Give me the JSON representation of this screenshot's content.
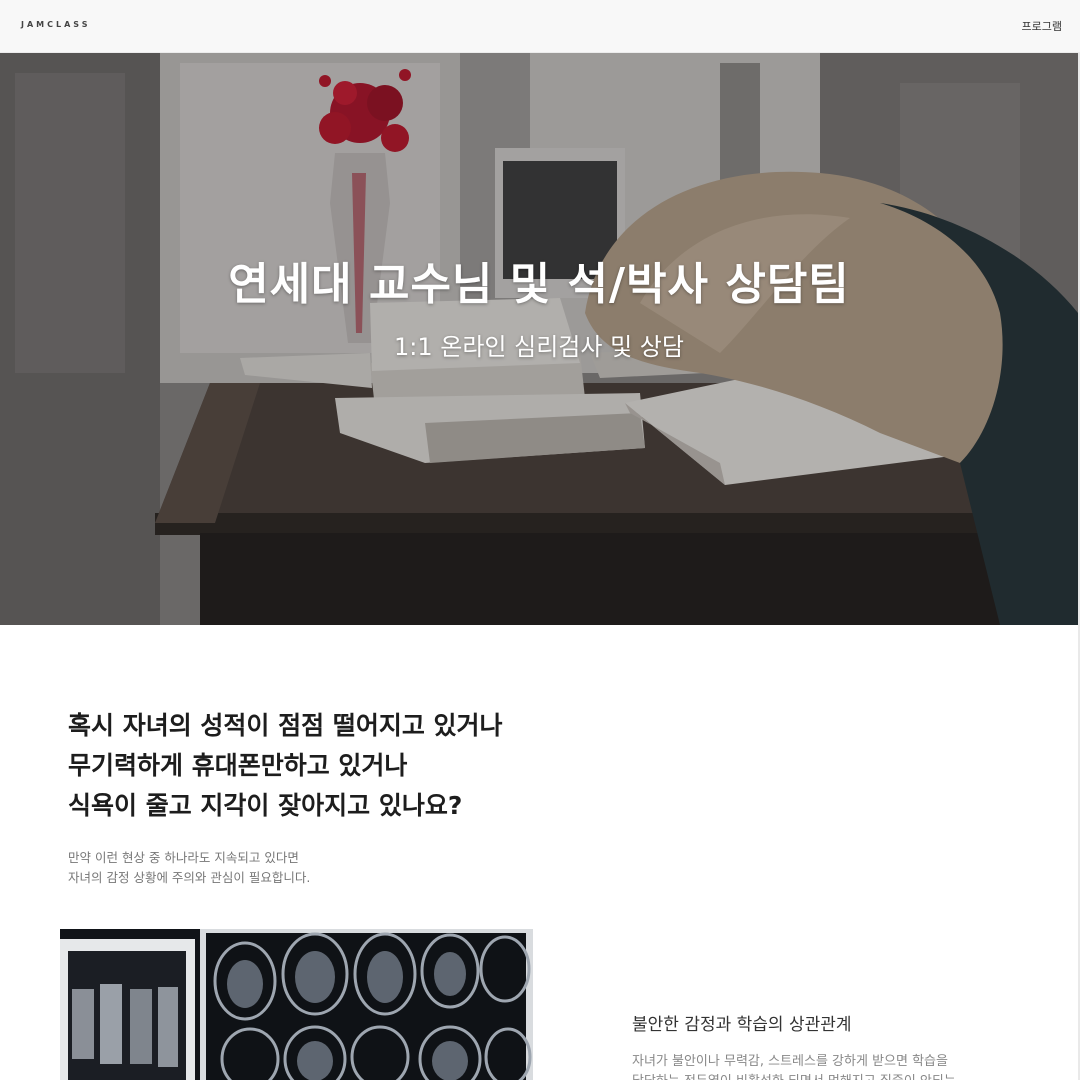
{
  "header": {
    "logo": "JAMCLASS",
    "nav_program": "프로그램"
  },
  "hero": {
    "title": "연세대 교수님 및 석/박사 상담팀",
    "subtitle": "1:1 온라인 심리검사 및 상담"
  },
  "intro": {
    "heading_lines": [
      "혹시 자녀의 성적이 점점 떨어지고 있거나",
      "무기력하게 휴대폰만하고 있거나",
      "식욕이 줄고 지각이 잦아지고 있나요?"
    ],
    "desc_lines": [
      "만약 이런 현상 중 하나라도 지속되고 있다면",
      "자녀의 감정 상황에 주의와 관심이 필요합니다."
    ]
  },
  "feature": {
    "title": "불안한 감정과 학습의 상관관계",
    "body_lines": [
      "자녀가 불안이나 무력감, 스트레스를 강하게 받으면 학습을",
      "담당하는 전두엽이 비활성화 되면서 멍해지고 집중이 안되는"
    ]
  },
  "colors": {
    "hero_overlay": "#1a1a1a",
    "flowers": "#c0142a",
    "heading": "#1d1d1d",
    "muted_text": "#777777"
  }
}
